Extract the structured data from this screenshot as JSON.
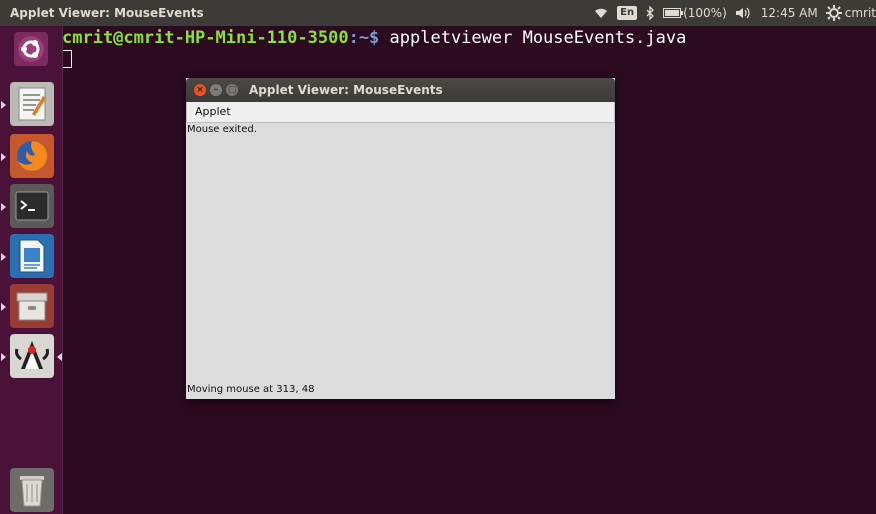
{
  "top_panel": {
    "window_title": "Applet Viewer: MouseEvents",
    "keyboard_layout": "En",
    "battery": "(100%)",
    "time": "12:45 AM",
    "user": "cmrit"
  },
  "launcher": {
    "items": [
      {
        "name": "Ubuntu Dash",
        "icon": "ubuntu-logo-icon"
      },
      {
        "name": "Text Editor",
        "icon": "text-editor-icon"
      },
      {
        "name": "Firefox",
        "icon": "firefox-icon"
      },
      {
        "name": "Terminal",
        "icon": "terminal-icon"
      },
      {
        "name": "LibreOffice Writer",
        "icon": "writer-icon"
      },
      {
        "name": "File Archive",
        "icon": "archive-icon"
      },
      {
        "name": "Java Applet Viewer",
        "icon": "java-duke-icon"
      },
      {
        "name": "Trash",
        "icon": "trash-icon"
      }
    ]
  },
  "terminal": {
    "prompt_user": "cmrit@cmrit-HP-Mini-110-3500",
    "prompt_path": ":~$",
    "command": " appletviewer MouseEvents.java"
  },
  "applet_window": {
    "title": "Applet Viewer: MouseEvents",
    "menu": "Applet",
    "status_top": "Mouse exited.",
    "status_bottom": "Moving mouse at 313, 48"
  },
  "colors": {
    "desktop_bg": "#2c0a20",
    "panel_bg": "#3c3b37",
    "launcher_bg": "#4a1238",
    "prompt_green": "#8ae234",
    "accent_orange": "#e95420"
  }
}
